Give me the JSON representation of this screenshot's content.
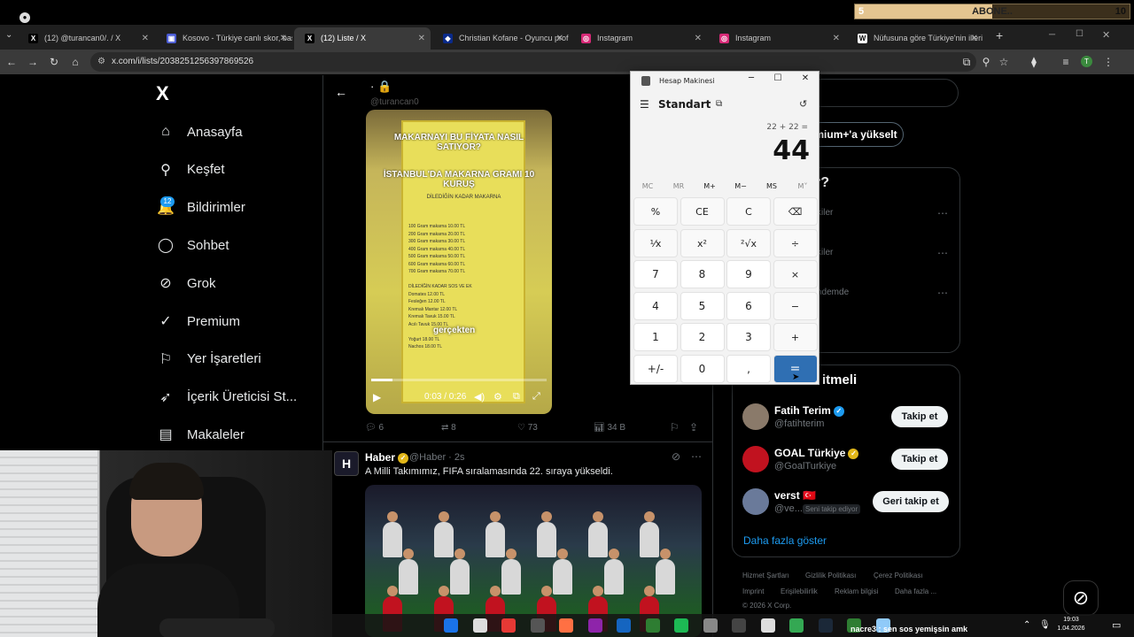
{
  "overlay": {
    "subscribe_label": "ABONE..",
    "sub_start": "5",
    "sub_end": "10",
    "progress_fraction": 0.5
  },
  "browser": {
    "tabs": [
      {
        "title": "(12) @turancan0/. / X",
        "icon": "x-icon"
      },
      {
        "title": "Kosovo - Türkiye canlı skor, baş",
        "icon": "score-icon"
      },
      {
        "title": "(12) Liste / X",
        "icon": "x-icon"
      },
      {
        "title": "Christian Kofane - Oyuncu profil",
        "icon": "site-icon"
      },
      {
        "title": "Instagram",
        "icon": "instagram-icon"
      },
      {
        "title": "Instagram",
        "icon": "instagram-icon"
      },
      {
        "title": "Nüfusuna göre Türkiye'nin illeri",
        "icon": "wikipedia-icon"
      }
    ],
    "url": "x.com/i/lists/2038251256397869526"
  },
  "sidebar": {
    "logo": "X",
    "badge": "12",
    "items": [
      {
        "label": "Anasayfa",
        "icon": "home-icon",
        "glyph": "⌂"
      },
      {
        "label": "Keşfet",
        "icon": "search-icon",
        "glyph": "⚲"
      },
      {
        "label": "Bildirimler",
        "icon": "bell-icon",
        "glyph": "🔔"
      },
      {
        "label": "Sohbet",
        "icon": "chat-icon",
        "glyph": "◯"
      },
      {
        "label": "Grok",
        "icon": "grok-icon",
        "glyph": "⊘"
      },
      {
        "label": "Premium",
        "icon": "premium-icon",
        "glyph": "✓"
      },
      {
        "label": "Yer İşaretleri",
        "icon": "bookmark-icon",
        "glyph": "⚐"
      },
      {
        "label": "İçerik Üreticisi St...",
        "icon": "rocket-icon",
        "glyph": "➶"
      },
      {
        "label": "Makaleler",
        "icon": "article-icon",
        "glyph": "▤"
      }
    ]
  },
  "timeline": {
    "header_handle": "@turancan0",
    "video": {
      "caption1": "MAKARNAYI BU FİYATA NASIL SATIYOR?",
      "caption2": "İSTANBUL'DA MAKARNA GRAMI 10 KURUŞ",
      "board_title": "DİLEDİĞİN KADAR MAKARNA",
      "menu_text": "100 Gram makarna 10.00 TL\n200 Gram makarna 20.00 TL\n300 Gram makarna 30.00 TL\n400 Gram makarna 40.00 TL\n500 Gram makarna 50.00 TL\n600 Gram makarna 60.00 TL\n700 Gram makarna 70.00 TL\n\nDİLEDİĞİN KADAR SOS VE EK\nDomates 12.00 TL\nFesleğen 12.00 TL\nKremalı Mantar 12.00 TL\nKremalı Tavuk 15.00 TL\nAcılı Tavuk 15.00 TL\n\nYoğurt 18.00 TL\nNachos 18.00 TL",
      "subtitle": "gerçekten",
      "time": "0:03 / 0:26",
      "progress_fraction": 0.12
    },
    "actions": {
      "replies": "6",
      "reposts": "8",
      "likes": "73",
      "views": "34 B"
    },
    "tweet2": {
      "avatar": "H",
      "name": "Haber",
      "handle": "@Haber · 2s",
      "text": "A Milli Takımımız, FIFA sıralamasında 22. sıraya yükseldi."
    }
  },
  "rightcol": {
    "premium_btn": "mium+'a yükselt",
    "trend_heading": "r?",
    "trends": [
      "kiler",
      "kiler",
      "ndemde"
    ],
    "follow_title": "itmeli",
    "follows": [
      {
        "name": "Fatih Terim",
        "handle": "@fatihterim",
        "button": "Takip et",
        "verified": "blue"
      },
      {
        "name": "GOAL Türkiye",
        "handle": "@GoalTurkiye",
        "button": "Takip et",
        "verified": "gold"
      },
      {
        "name": "verst 🇹🇷",
        "handle": "@ve...",
        "button": "Geri takip et",
        "tag": "Seni takip ediyor"
      }
    ],
    "more": "Daha fazla göster",
    "footer": [
      "Hizmet Şartları",
      "Gizlilik Politikası",
      "Çerez Politikası",
      "Imprint",
      "Erişilebilirlik",
      "Reklam bilgisi",
      "Daha fazla ...",
      "© 2026 X Corp."
    ]
  },
  "calculator": {
    "title": "Hesap Makinesi",
    "mode": "Standart",
    "expression": "22 + 22 =",
    "result": "44",
    "memory": [
      "MC",
      "MR",
      "M+",
      "M−",
      "MS",
      "M˅"
    ],
    "keys": [
      [
        "%",
        "CE",
        "C",
        "⌫"
      ],
      [
        "⅟x",
        "x²",
        "²√x",
        "÷"
      ],
      [
        "7",
        "8",
        "9",
        "×"
      ],
      [
        "4",
        "5",
        "6",
        "−"
      ],
      [
        "1",
        "2",
        "3",
        "+"
      ],
      [
        "+/-",
        "0",
        ",",
        "="
      ]
    ]
  },
  "taskbar": {
    "chat": "nacre3 : sen sos yemişsin amk",
    "time": "19:03",
    "date": "1.04.2026"
  }
}
